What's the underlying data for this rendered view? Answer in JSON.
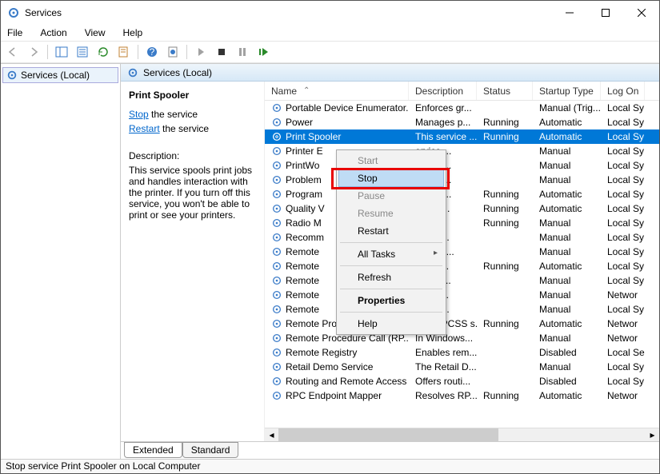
{
  "window": {
    "title": "Services"
  },
  "menubar": [
    "File",
    "Action",
    "View",
    "Help"
  ],
  "nav": {
    "label": "Services (Local)"
  },
  "mainHeader": "Services (Local)",
  "detail": {
    "title": "Print Spooler",
    "stop_pre": "Stop",
    "stop_post": " the service",
    "restart_pre": "Restart",
    "restart_post": " the service",
    "desc_label": "Description:",
    "desc_text": "This service spools print jobs and handles interaction with the printer. If you turn off this service, you won't be able to print or see your printers."
  },
  "columns": {
    "name": "Name",
    "desc": "Description",
    "status": "Status",
    "startup": "Startup Type",
    "logon": "Log On"
  },
  "rows": [
    {
      "name": "Portable Device Enumerator...",
      "desc": "Enforces gr...",
      "status": "",
      "startup": "Manual (Trig...",
      "logon": "Local Sy"
    },
    {
      "name": "Power",
      "desc": "Manages p...",
      "status": "Running",
      "startup": "Automatic",
      "logon": "Local Sy"
    },
    {
      "name": "Print Spooler",
      "desc": "This service ...",
      "status": "Running",
      "startup": "Automatic",
      "logon": "Local Sy",
      "selected": true
    },
    {
      "name": "Printer E",
      "desc": "ervice ...",
      "status": "",
      "startup": "Manual",
      "logon": "Local Sy"
    },
    {
      "name": "PrintWo",
      "desc": "des su...",
      "status": "",
      "startup": "Manual",
      "logon": "Local Sy"
    },
    {
      "name": "Problem",
      "desc": "ervice ...",
      "status": "",
      "startup": "Manual",
      "logon": "Local Sy"
    },
    {
      "name": "Program",
      "desc": "ervice ...",
      "status": "Running",
      "startup": "Automatic",
      "logon": "Local Sy"
    },
    {
      "name": "Quality V",
      "desc": "ty Win...",
      "status": "Running",
      "startup": "Automatic",
      "logon": "Local Sy"
    },
    {
      "name": "Radio M",
      "desc": " Mana...",
      "status": "Running",
      "startup": "Manual",
      "logon": "Local Sy"
    },
    {
      "name": "Recomm",
      "desc": "es aut...",
      "status": "",
      "startup": "Manual",
      "logon": "Local Sy"
    },
    {
      "name": "Remote ",
      "desc": "es a co...",
      "status": "",
      "startup": "Manual",
      "logon": "Local Sy"
    },
    {
      "name": "Remote ",
      "desc": "ges di...",
      "status": "Running",
      "startup": "Automatic",
      "logon": "Local Sy"
    },
    {
      "name": "Remote ",
      "desc": "te Des...",
      "status": "",
      "startup": "Manual",
      "logon": "Local Sy"
    },
    {
      "name": "Remote ",
      "desc": "s user...",
      "status": "",
      "startup": "Manual",
      "logon": "Networ"
    },
    {
      "name": "Remote ",
      "desc": "s the r...",
      "status": "",
      "startup": "Manual",
      "logon": "Local Sy"
    },
    {
      "name": "Remote Procedure Call (RPC)",
      "desc": "The RPCSS s...",
      "status": "Running",
      "startup": "Automatic",
      "logon": "Networ"
    },
    {
      "name": "Remote Procedure Call (RP...",
      "desc": "In Windows...",
      "status": "",
      "startup": "Manual",
      "logon": "Networ"
    },
    {
      "name": "Remote Registry",
      "desc": "Enables rem...",
      "status": "",
      "startup": "Disabled",
      "logon": "Local Se"
    },
    {
      "name": "Retail Demo Service",
      "desc": "The Retail D...",
      "status": "",
      "startup": "Manual",
      "logon": "Local Sy"
    },
    {
      "name": "Routing and Remote Access",
      "desc": "Offers routi...",
      "status": "",
      "startup": "Disabled",
      "logon": "Local Sy"
    },
    {
      "name": "RPC Endpoint Mapper",
      "desc": "Resolves RP...",
      "status": "Running",
      "startup": "Automatic",
      "logon": "Networ"
    }
  ],
  "tabs": {
    "extended": "Extended",
    "standard": "Standard"
  },
  "context": {
    "start": "Start",
    "stop": "Stop",
    "pause": "Pause",
    "resume": "Resume",
    "restart": "Restart",
    "alltasks": "All Tasks",
    "refresh": "Refresh",
    "properties": "Properties",
    "help": "Help"
  },
  "status": "Stop service Print Spooler on Local Computer"
}
